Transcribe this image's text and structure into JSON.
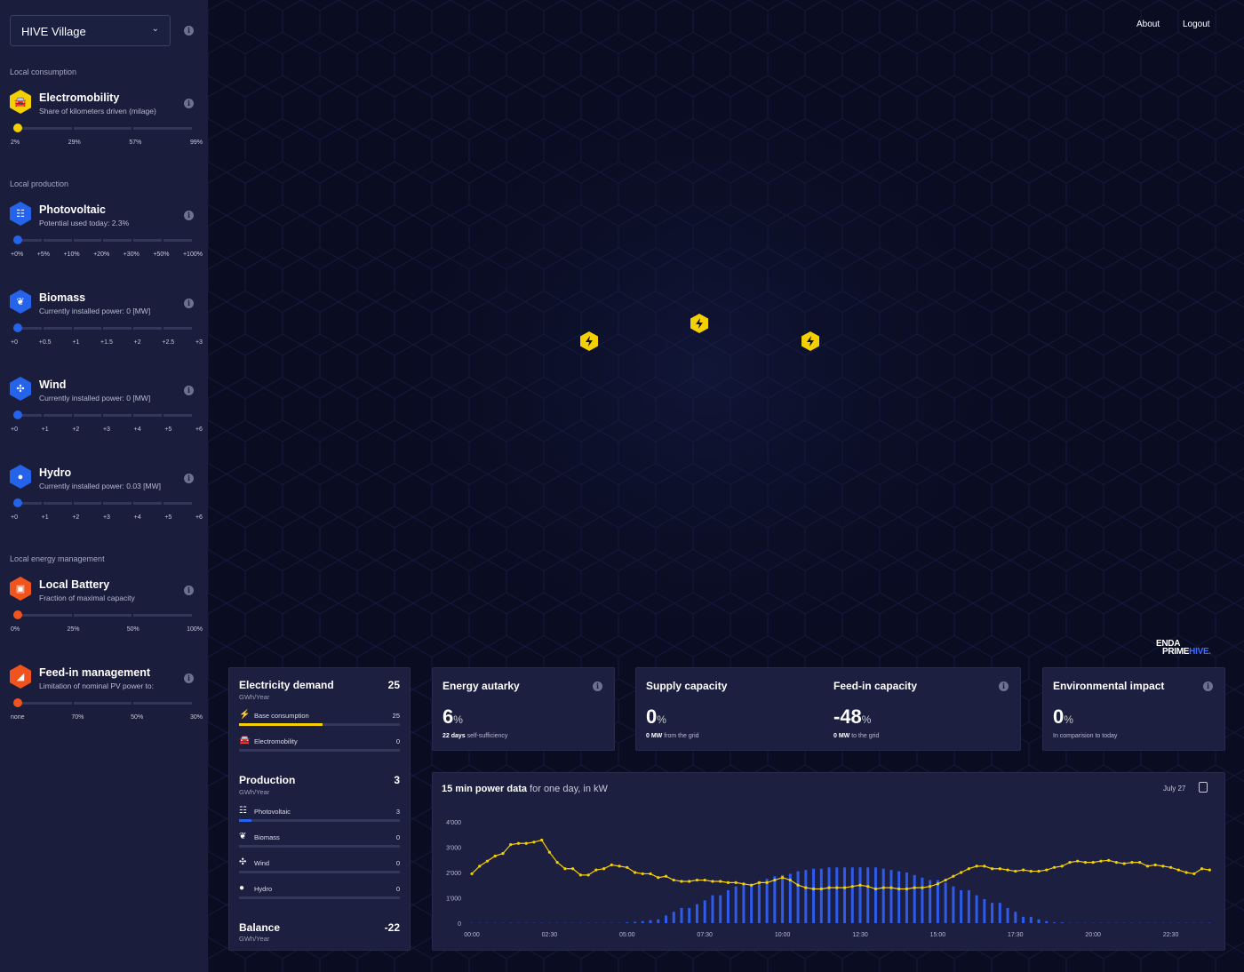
{
  "header": {
    "about": "About",
    "logout": "Logout"
  },
  "logo": {
    "line1": "ENDA",
    "line2a": "PRIME",
    "line2b": "HIVE."
  },
  "sidebar": {
    "location": "HIVE Village",
    "sections": [
      "Local consumption",
      "Local production",
      "Local energy management"
    ],
    "items": [
      {
        "title": "Electromobility",
        "subtitle": "Share of kilometers driven (milage)",
        "icon": "car-icon",
        "color": "#f5d000",
        "ticks": [
          "2%",
          "29%",
          "57%",
          "99%"
        ],
        "value_index": 0
      },
      {
        "title": "Photovoltaic",
        "subtitle": "Potential used today: 2.3%",
        "icon": "solar-panel-icon",
        "color": "#2563eb",
        "ticks": [
          "+0%",
          "+5%",
          "+10%",
          "+20%",
          "+30%",
          "+50%",
          "+100%"
        ],
        "value_index": 0
      },
      {
        "title": "Biomass",
        "subtitle": "Currently installed power: 0 [MW]",
        "icon": "plant-icon",
        "color": "#2563eb",
        "ticks": [
          "+0",
          "+0.5",
          "+1",
          "+1.5",
          "+2",
          "+2.5",
          "+3"
        ],
        "value_index": 0
      },
      {
        "title": "Wind",
        "subtitle": "Currently installed power: 0 [MW]",
        "icon": "wind-turbine-icon",
        "color": "#2563eb",
        "ticks": [
          "+0",
          "+1",
          "+2",
          "+3",
          "+4",
          "+5",
          "+6"
        ],
        "value_index": 0
      },
      {
        "title": "Hydro",
        "subtitle": "Currently installed power: 0.03 [MW]",
        "icon": "water-drops-icon",
        "color": "#2563eb",
        "ticks": [
          "+0",
          "+1",
          "+2",
          "+3",
          "+4",
          "+5",
          "+6"
        ],
        "value_index": 0
      },
      {
        "title": "Local Battery",
        "subtitle": "Fraction of maximal capacity",
        "icon": "battery-icon",
        "color": "#f0531c",
        "ticks": [
          "0%",
          "25%",
          "50%",
          "100%"
        ],
        "value_index": 0
      },
      {
        "title": "Feed-in management",
        "subtitle": "Limitation of nominal PV power to:",
        "icon": "area-chart-icon",
        "color": "#f0531c",
        "ticks": [
          "none",
          "70%",
          "50%",
          "30%"
        ],
        "value_index": 0
      }
    ]
  },
  "demand": {
    "title": "Electricity demand",
    "value": "25",
    "unit": "GWh/Year",
    "rows": [
      {
        "label": "Base consumption",
        "value": "25",
        "icon": "bolt-icon",
        "fill": 0.52,
        "color": "#f5d000"
      },
      {
        "label": "Electromobility",
        "value": "0",
        "icon": "car-icon",
        "fill": 0,
        "color": "#f5d000"
      }
    ]
  },
  "production": {
    "title": "Production",
    "value": "3",
    "unit": "GWh/Year",
    "rows": [
      {
        "label": "Photovoltaic",
        "value": "3",
        "icon": "solar-panel-icon",
        "fill": 0.08,
        "color": "#2563eb"
      },
      {
        "label": "Biomass",
        "value": "0",
        "icon": "plant-icon",
        "fill": 0,
        "color": "#2563eb"
      },
      {
        "label": "Wind",
        "value": "0",
        "icon": "wind-turbine-icon",
        "fill": 0,
        "color": "#2563eb"
      },
      {
        "label": "Hydro",
        "value": "0",
        "icon": "water-drops-icon",
        "fill": 0,
        "color": "#2563eb"
      }
    ]
  },
  "balance": {
    "title": "Balance",
    "value": "-22",
    "unit": "GWh/Year"
  },
  "stats": {
    "autarky": {
      "title": "Energy autarky",
      "value": "6",
      "unit": "%",
      "note_bold": "22 days",
      "note": "self-sufficiency"
    },
    "supply": {
      "title": "Supply capacity",
      "value": "0",
      "unit": "%",
      "note_bold": "0 MW",
      "note": "from the grid"
    },
    "feedin": {
      "title": "Feed-in capacity",
      "value": "-48",
      "unit": "%",
      "note_bold": "0 MW",
      "note": "to the grid"
    },
    "env": {
      "title": "Environmental impact",
      "value": "0",
      "unit": "%",
      "note": "In comparision to today"
    }
  },
  "chart_data": {
    "type": "bar+line",
    "title_bold": "15 min power data",
    "title_rest": "for one day, in kW",
    "date": "July 27",
    "ylim": [
      0,
      4000
    ],
    "yticks": [
      "0",
      "1'000",
      "2'000",
      "3'000",
      "4'000"
    ],
    "xticks": [
      "00:00",
      "02:30",
      "05:00",
      "07:30",
      "10:00",
      "12:30",
      "15:00",
      "17:30",
      "20:00",
      "22:30"
    ],
    "interval_minutes": 15,
    "series": [
      {
        "type": "bar",
        "color": "#2f5bea",
        "values": [
          0,
          0,
          0,
          0,
          0,
          0,
          0,
          0,
          0,
          0,
          0,
          0,
          0,
          0,
          0,
          0,
          0,
          0,
          0,
          0,
          20,
          50,
          80,
          120,
          150,
          300,
          450,
          600,
          600,
          750,
          900,
          1100,
          1100,
          1300,
          1450,
          1550,
          1550,
          1650,
          1750,
          1850,
          1900,
          1950,
          2050,
          2100,
          2150,
          2150,
          2200,
          2200,
          2200,
          2200,
          2200,
          2200,
          2200,
          2150,
          2100,
          2050,
          2000,
          1900,
          1800,
          1700,
          1700,
          1600,
          1450,
          1300,
          1300,
          1100,
          950,
          800,
          800,
          600,
          450,
          250,
          250,
          150,
          80,
          30,
          10,
          0,
          0,
          0,
          0,
          0,
          0,
          0,
          0,
          0,
          0,
          0,
          0,
          0,
          0,
          0,
          0,
          0,
          0,
          0
        ]
      },
      {
        "type": "line",
        "color": "#f5d000",
        "values": [
          1950,
          2250,
          2450,
          2650,
          2750,
          3100,
          3150,
          3150,
          3200,
          3280,
          2800,
          2400,
          2150,
          2150,
          1900,
          1900,
          2100,
          2150,
          2300,
          2250,
          2200,
          2000,
          1950,
          1950,
          1800,
          1850,
          1700,
          1650,
          1650,
          1700,
          1700,
          1650,
          1650,
          1600,
          1600,
          1550,
          1500,
          1600,
          1600,
          1700,
          1800,
          1700,
          1500,
          1400,
          1350,
          1350,
          1400,
          1400,
          1400,
          1450,
          1500,
          1450,
          1350,
          1400,
          1400,
          1350,
          1350,
          1400,
          1400,
          1450,
          1550,
          1700,
          1850,
          2000,
          2150,
          2250,
          2250,
          2150,
          2150,
          2100,
          2050,
          2100,
          2050,
          2050,
          2100,
          2200,
          2250,
          2400,
          2450,
          2400,
          2400,
          2450,
          2480,
          2400,
          2350,
          2400,
          2400,
          2250,
          2300,
          2250,
          2200,
          2100,
          2000,
          1950,
          2150,
          2100
        ]
      }
    ]
  },
  "colors": {
    "sidebar": "#1a1d3b",
    "background": "#0a0c22",
    "card": "#1c1f3f",
    "marker": "#f5d000"
  }
}
